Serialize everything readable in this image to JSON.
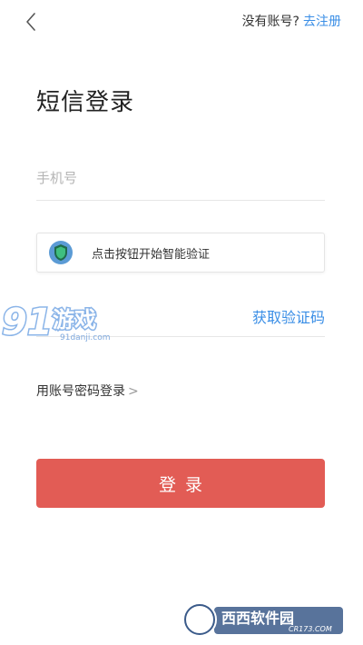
{
  "header": {
    "no_account_text": "没有账号?",
    "register_label": "去注册"
  },
  "title": "短信登录",
  "phone": {
    "placeholder": "手机号"
  },
  "captcha": {
    "label": "点击按钮开始智能验证"
  },
  "code": {
    "placeholder": "",
    "get_code_label": "获取验证码"
  },
  "password_login": {
    "label": "用账号密码登录",
    "chevron": ">"
  },
  "login_button": {
    "label": "登录"
  },
  "watermarks": {
    "top_main": "游戏",
    "top_url": "91danji.com",
    "bottom_main": "西西软件园",
    "bottom_url": "CR173.COM"
  },
  "colors": {
    "accent_blue": "#3a8ee6",
    "login_red": "#e25c55"
  },
  "icons": {
    "back": "chevron-left-icon",
    "captcha": "shield-icon"
  }
}
